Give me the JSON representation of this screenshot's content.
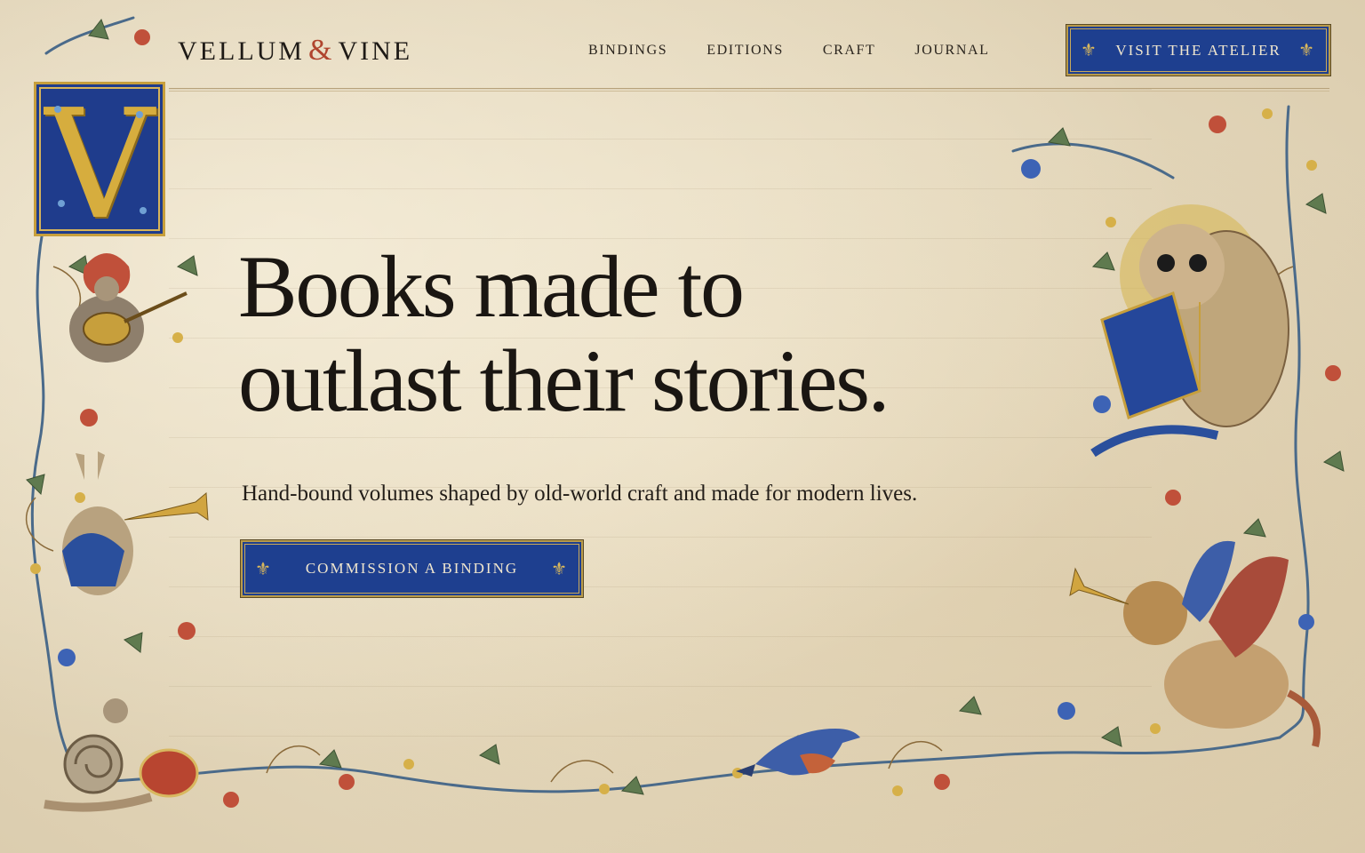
{
  "brand": {
    "name_left": "VELLUM",
    "ampersand": "&",
    "name_right": "VINE"
  },
  "nav": {
    "items": [
      {
        "label": "BINDINGS"
      },
      {
        "label": "EDITIONS"
      },
      {
        "label": "CRAFT"
      },
      {
        "label": "JOURNAL"
      }
    ]
  },
  "header": {
    "cta_label": "VISIT THE ATELIER",
    "cta_icon": "fleur-de-lis-icon"
  },
  "hero": {
    "initial_letter": "V",
    "headline_line1": "Books made to",
    "headline_line2": "outlast their stories.",
    "subtitle": "Hand-bound volumes shaped by old-world craft and made for modern lives.",
    "cta_label": "COMMISSION A BINDING",
    "cta_icon": "fleur-de-lis-icon"
  },
  "colors": {
    "parchment": "#ede2c8",
    "lapis_blue": "#1e3f8f",
    "gold": "#c79f3c",
    "vermilion": "#b0452e",
    "ink": "#1a1612"
  },
  "illustrations": [
    "monkey-lute-player",
    "rabbit-trumpeter",
    "snail-drummer",
    "blue-bird",
    "owl-reading-book",
    "winged-lion-trumpeter",
    "floral-vine-border"
  ]
}
